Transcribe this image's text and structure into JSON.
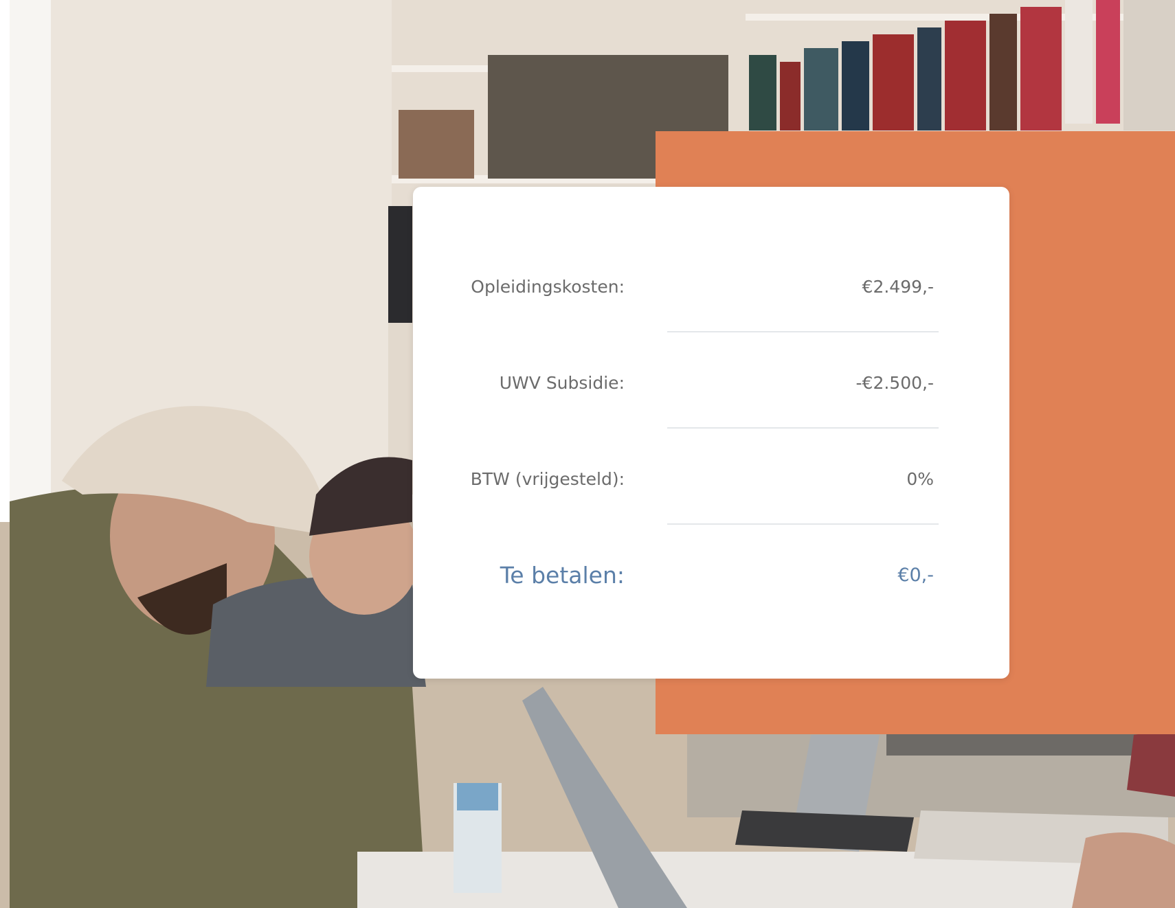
{
  "colors": {
    "accent_panel": "#e08155",
    "card_background": "#ffffff",
    "label_text": "#6b6b6b",
    "total_text": "#5b7fa8"
  },
  "background_image": "office-photo-people-at-laptops-with-bookshelf",
  "pricing": {
    "rows": [
      {
        "label": "Opleidingskosten:",
        "value": "€2.499,-"
      },
      {
        "label": "UWV Subsidie:",
        "value": "-€2.500,-"
      },
      {
        "label": "BTW (vrijgesteld):",
        "value": "0%"
      }
    ],
    "total": {
      "label": "Te betalen:",
      "value": "€0,-"
    }
  }
}
